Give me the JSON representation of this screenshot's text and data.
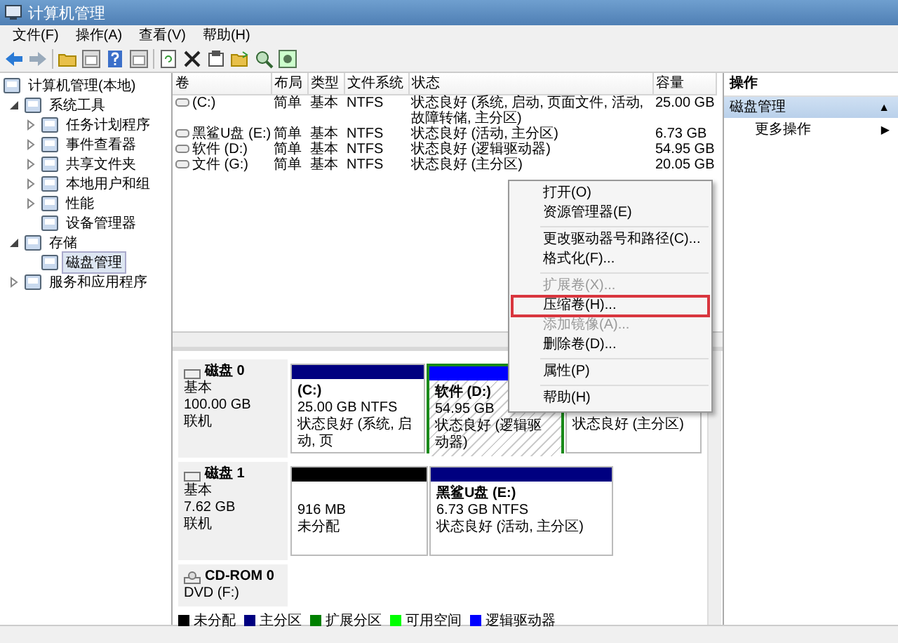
{
  "window": {
    "title": "计算机管理"
  },
  "menu": [
    "文件(F)",
    "操作(A)",
    "查看(V)",
    "帮助(H)"
  ],
  "tree": [
    {
      "label": "计算机管理(本地)",
      "selected": false,
      "children": [
        {
          "label": "系统工具",
          "expanded": true,
          "selected": false,
          "children": [
            {
              "label": "任务计划程序",
              "expanded": false,
              "selected": false
            },
            {
              "label": "事件查看器",
              "expanded": false,
              "selected": false
            },
            {
              "label": "共享文件夹",
              "expanded": false,
              "selected": false
            },
            {
              "label": "本地用户和组",
              "expanded": false,
              "selected": false
            },
            {
              "label": "性能",
              "expanded": false,
              "selected": false
            },
            {
              "label": "设备管理器",
              "selected": false
            }
          ]
        },
        {
          "label": "存储",
          "expanded": true,
          "selected": false,
          "children": [
            {
              "label": "磁盘管理",
              "selected": true
            }
          ]
        },
        {
          "label": "服务和应用程序",
          "expanded": false,
          "selected": false
        }
      ]
    }
  ],
  "table": {
    "columns": [
      "卷",
      "布局",
      "类型",
      "文件系统",
      "状态",
      "容量"
    ],
    "rows": [
      {
        "volume": "(C:)",
        "layout": "简单",
        "type": "基本",
        "filesystem": "NTFS",
        "status": "状态良好 (系统, 启动, 页面文件, 活动, 故障转储, 主分区)",
        "capacity": "25.00 GB"
      },
      {
        "volume": "黑鲨U盘 (E:)",
        "layout": "简单",
        "type": "基本",
        "filesystem": "NTFS",
        "status": "状态良好 (活动, 主分区)",
        "capacity": "6.73 GB"
      },
      {
        "volume": "软件 (D:)",
        "layout": "简单",
        "type": "基本",
        "filesystem": "NTFS",
        "status": "状态良好 (逻辑驱动器)",
        "capacity": "54.95 GB"
      },
      {
        "volume": "文件 (G:)",
        "layout": "简单",
        "type": "基本",
        "filesystem": "NTFS",
        "status": "状态良好 (主分区)",
        "capacity": "20.05 GB"
      }
    ]
  },
  "disks": [
    {
      "name": "磁盘 0",
      "type": "基本",
      "size": "100.00 GB",
      "state": "联机",
      "partitions": [
        {
          "kind": "primary",
          "selected": false,
          "name": "(C:)",
          "size": "25.00 GB NTFS",
          "status": "状态良好 (系统, 启动, 页"
        },
        {
          "kind": "logical",
          "selected": true,
          "name": "软件  (D:)",
          "size": "54.95 GB",
          "status": "状态良好 (逻辑驱动器)"
        },
        {
          "kind": "primary",
          "selected": false,
          "status": "状态良好 (主分区)"
        }
      ]
    },
    {
      "name": "磁盘 1",
      "type": "基本",
      "size": "7.62 GB",
      "state": "联机",
      "partitions": [
        {
          "kind": "unallocated",
          "selected": false,
          "size": "916 MB",
          "status": "未分配"
        },
        {
          "kind": "primary",
          "selected": false,
          "name": "黑鲨U盘  (E:)",
          "size": "6.73 GB NTFS",
          "status": "状态良好 (活动, 主分区)"
        }
      ]
    },
    {
      "name": "CD-ROM 0",
      "type": "DVD (F:)"
    }
  ],
  "legend": [
    {
      "label": "未分配",
      "color": "#000000"
    },
    {
      "label": "主分区",
      "color": "#000080"
    },
    {
      "label": "扩展分区",
      "color": "#008000"
    },
    {
      "label": "可用空间",
      "color": "#00ff00"
    },
    {
      "label": "逻辑驱动器",
      "color": "#0000ff"
    }
  ],
  "context_menu": [
    {
      "kind": "item",
      "label": "打开(O)",
      "disabled": false,
      "highlighted": false
    },
    {
      "kind": "item",
      "label": "资源管理器(E)",
      "disabled": false,
      "highlighted": false
    },
    {
      "kind": "separator"
    },
    {
      "kind": "item",
      "label": "更改驱动器号和路径(C)...",
      "disabled": false,
      "highlighted": false
    },
    {
      "kind": "item",
      "label": "格式化(F)...",
      "disabled": false,
      "highlighted": false
    },
    {
      "kind": "separator"
    },
    {
      "kind": "item",
      "label": "扩展卷(X)...",
      "disabled": true,
      "highlighted": false
    },
    {
      "kind": "item",
      "label": "压缩卷(H)...",
      "disabled": false,
      "highlighted": true
    },
    {
      "kind": "item",
      "label": "添加镜像(A)...",
      "disabled": true,
      "highlighted": false
    },
    {
      "kind": "item",
      "label": "删除卷(D)...",
      "disabled": false,
      "highlighted": false
    },
    {
      "kind": "separator"
    },
    {
      "kind": "item",
      "label": "属性(P)",
      "disabled": false,
      "highlighted": false
    },
    {
      "kind": "separator"
    },
    {
      "kind": "item",
      "label": "帮助(H)",
      "disabled": false,
      "highlighted": false
    }
  ],
  "actions": {
    "title": "操作",
    "section": {
      "label": "磁盘管理",
      "arrow": "▲"
    },
    "items": [
      {
        "label": "更多操作",
        "arrow": "▶"
      }
    ]
  }
}
